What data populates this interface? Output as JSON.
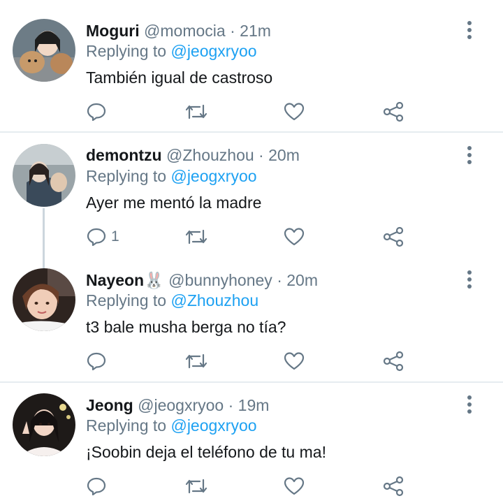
{
  "tweets": [
    {
      "name": "Moguri",
      "emoji": "",
      "handle": "@momocia",
      "sep": " · ",
      "time": "21m",
      "replying_prefix": "Replying to ",
      "replying_to": "@jeogxryoo",
      "text": "También igual de castroso",
      "reply_count": "",
      "avatar_colors": [
        "#5a6b78",
        "#c9a27a",
        "#2a2a2a"
      ]
    },
    {
      "name": "demontzu",
      "emoji": "",
      "handle": "@Zhouzhou",
      "sep": " · ",
      "time": "20m",
      "replying_prefix": "Replying to ",
      "replying_to": "@jeogxryoo",
      "text": "Ayer me mentó la madre",
      "reply_count": "1",
      "avatar_colors": [
        "#9aa4a8",
        "#d8c8b8",
        "#3a4a5a"
      ]
    },
    {
      "name": "Nayeon",
      "emoji": "🐰",
      "handle": "@bunnyhoney",
      "sep": " · ",
      "time": "20m",
      "replying_prefix": "Replying to ",
      "replying_to": "@Zhouzhou",
      "text": "t3 bale musha berga no tía?",
      "reply_count": "",
      "avatar_colors": [
        "#3a2a22",
        "#e8c0a8",
        "#8b5a3c"
      ]
    },
    {
      "name": "Jeong",
      "emoji": "",
      "handle": "@jeogxryoo",
      "sep": " · ",
      "time": "19m",
      "replying_prefix": "Replying to ",
      "replying_to": "@jeogxryoo",
      "text": "¡Soobin deja el teléfono de tu ma!",
      "reply_count": "",
      "avatar_colors": [
        "#2e2a28",
        "#f0d0c0",
        "#1a1614"
      ]
    }
  ],
  "colors": {
    "text": "#14171a",
    "secondary": "#657786",
    "link": "#1da1f2",
    "divider": "#e6ecf0"
  }
}
